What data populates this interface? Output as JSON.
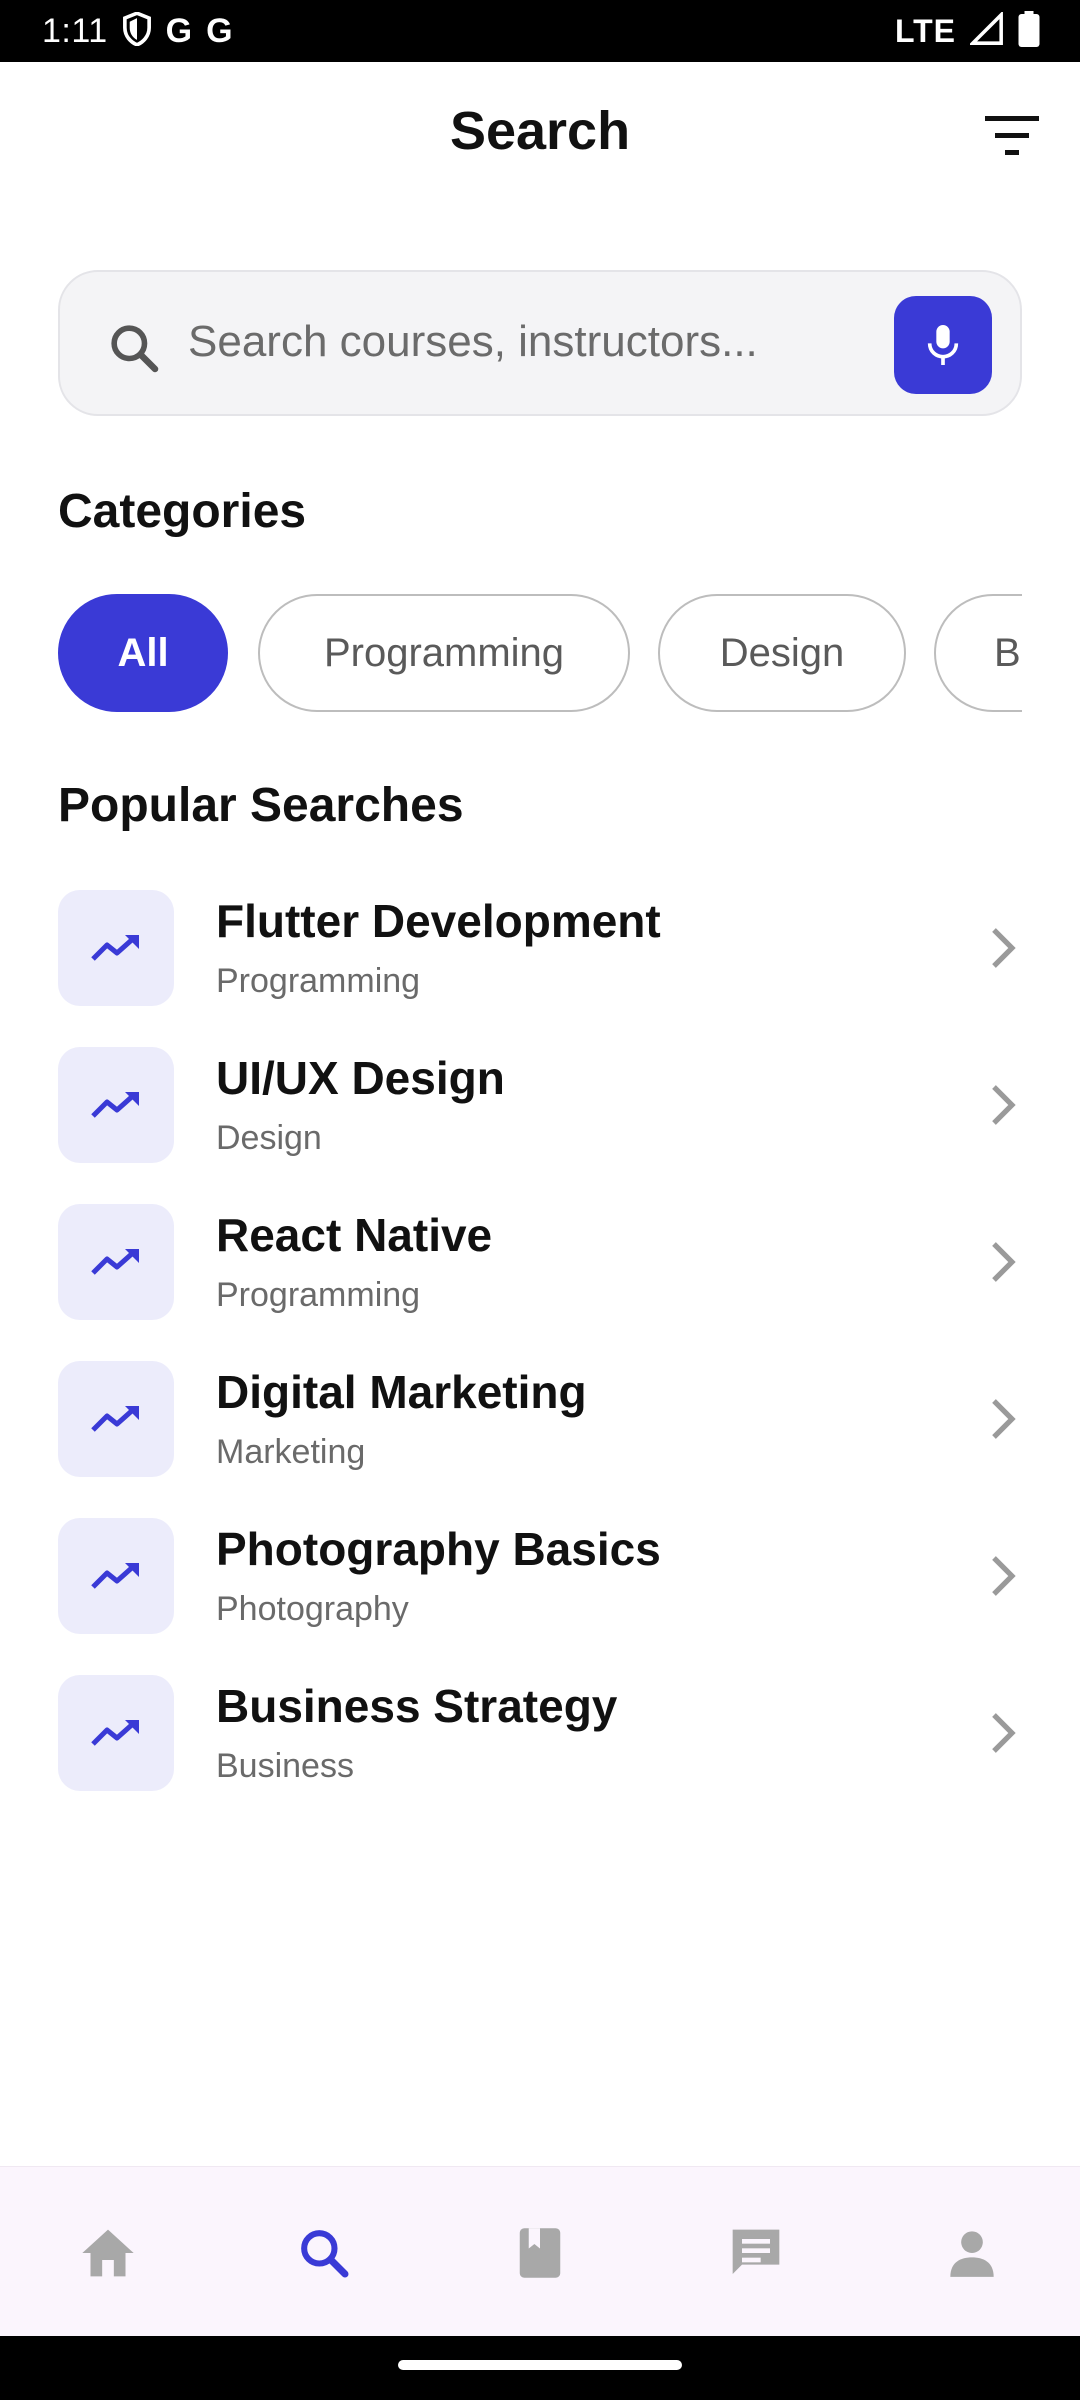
{
  "status_bar": {
    "time": "1:11",
    "g1": "G",
    "g2": "G",
    "network": "LTE"
  },
  "header": {
    "title": "Search"
  },
  "search": {
    "placeholder": "Search courses, instructors..."
  },
  "categories": {
    "title": "Categories",
    "chips": [
      {
        "label": "All",
        "active": true
      },
      {
        "label": "Programming",
        "active": false
      },
      {
        "label": "Design",
        "active": false
      },
      {
        "label": "B",
        "active": false
      }
    ]
  },
  "popular": {
    "title": "Popular Searches",
    "items": [
      {
        "title": "Flutter Development",
        "category": "Programming"
      },
      {
        "title": "UI/UX Design",
        "category": "Design"
      },
      {
        "title": "React Native",
        "category": "Programming"
      },
      {
        "title": "Digital Marketing",
        "category": "Marketing"
      },
      {
        "title": "Photography Basics",
        "category": "Photography"
      },
      {
        "title": "Business Strategy",
        "category": "Business"
      }
    ]
  },
  "nav": {
    "items": [
      {
        "icon": "home-icon",
        "active": false
      },
      {
        "icon": "search-icon",
        "active": true
      },
      {
        "icon": "book-icon",
        "active": false
      },
      {
        "icon": "chat-icon",
        "active": false
      },
      {
        "icon": "person-icon",
        "active": false
      }
    ]
  },
  "colors": {
    "accent": "#3a3ad6",
    "icon_bg": "#ececfb",
    "nav_bg": "#fbf5fd",
    "inactive_icon": "#a8a8a8"
  }
}
